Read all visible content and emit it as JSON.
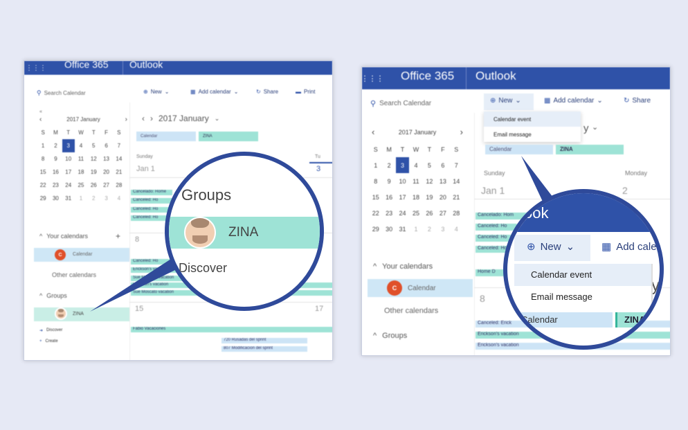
{
  "left_panel": {
    "app_title": "Office 365",
    "app_name": "Outlook",
    "search_placeholder": "Search Calendar",
    "toolbar": {
      "new": "New",
      "add_calendar": "Add calendar",
      "share": "Share",
      "print": "Print"
    },
    "mini_cal": {
      "month_label": "2017 January",
      "weekdays": [
        "S",
        "M",
        "T",
        "W",
        "T",
        "F",
        "S"
      ],
      "weeks": [
        [
          "1",
          "2",
          "3",
          "4",
          "5",
          "6",
          "7"
        ],
        [
          "8",
          "9",
          "10",
          "11",
          "12",
          "13",
          "14"
        ],
        [
          "15",
          "16",
          "17",
          "18",
          "19",
          "20",
          "21"
        ],
        [
          "22",
          "23",
          "24",
          "25",
          "26",
          "27",
          "28"
        ],
        [
          "29",
          "30",
          "31",
          "1",
          "2",
          "3",
          "4"
        ]
      ],
      "today": "3"
    },
    "your_calendars": "Your calendars",
    "calendar_item": "Calendar",
    "avatar_letter": "C",
    "other_calendars": "Other calendars",
    "groups": "Groups",
    "group_item": "ZINA",
    "discover": "Discover",
    "create": "Create",
    "main": {
      "header_title": "2017 January",
      "tag_calendar": "Calendar",
      "tag_zina": "ZINA",
      "day_sunday": "Sunday",
      "day_tue_partial": "Tu",
      "date_jan1": "Jan 1",
      "date_3": "3",
      "date_8": "8",
      "date_15": "15",
      "date_17": "17",
      "events": [
        "Cancelado: Home",
        "Canceled: Ho",
        "Canceled: Ho",
        "Canceled: Ho",
        "Canceled: Ho",
        "Erickson's vacation",
        "Sue Morocco vacation",
        "Fabio Vacaciones",
        "Canceled: Ho",
        "Erickson's vacation",
        "Sue Moscato vacation",
        "Fabio Vacaciones",
        "720 Rusadas del sprint",
        "807 Modificacion del sprint"
      ]
    },
    "magnifier": {
      "groups": "Groups",
      "member": "ZINA",
      "discover": "Discover"
    }
  },
  "right_panel": {
    "app_title": "Office 365",
    "app_name": "Outlook",
    "search_placeholder": "Search Calendar",
    "toolbar": {
      "new": "New",
      "add_calendar": "Add calendar",
      "share": "Share"
    },
    "new_menu": [
      "Calendar event",
      "Email message"
    ],
    "header_partial": "y",
    "mini_cal": {
      "month_label": "2017 January",
      "weekdays": [
        "S",
        "M",
        "T",
        "W",
        "T",
        "F",
        "S"
      ],
      "weeks": [
        [
          "1",
          "2",
          "3",
          "4",
          "5",
          "6",
          "7"
        ],
        [
          "8",
          "9",
          "10",
          "11",
          "12",
          "13",
          "14"
        ],
        [
          "15",
          "16",
          "17",
          "18",
          "19",
          "20",
          "21"
        ],
        [
          "22",
          "23",
          "24",
          "25",
          "26",
          "27",
          "28"
        ],
        [
          "29",
          "30",
          "31",
          "1",
          "2",
          "3",
          "4"
        ]
      ],
      "today": "3"
    },
    "your_calendars": "Your calendars",
    "calendar_item": "Calendar",
    "avatar_letter": "C",
    "other_calendars": "Other calendars",
    "groups": "Groups",
    "main": {
      "tag_calendar": "Calendar",
      "tag_zina": "ZINA",
      "day_sunday": "Sunday",
      "day_monday": "Monday",
      "date_jan1": "Jan 1",
      "date_2": "2",
      "date_8": "8",
      "events": [
        "Cancelado: Hom",
        "Canceled: Ho",
        "Canceled: Ho",
        "Canceled: Ho",
        "Home D",
        "Canceled: Erick",
        "Erickson's vacation",
        "Erickson's vacation"
      ]
    },
    "magnifier": {
      "app_name_partial": "ook",
      "new": "New",
      "add_calendar_partial": "Add cale",
      "menu": [
        "Calendar event",
        "Email message"
      ],
      "tag_calendar": "Calendar",
      "tag_zina": "ZINA",
      "partial_y": "y"
    }
  },
  "colors": {
    "brand": "#2f52a8",
    "today": "#2f52a8",
    "teal": "#9ee3d6",
    "light_blue": "#cde4f6",
    "avatar": "#e0502a",
    "ring": "#2f4a9a",
    "background": "#e6e9f5"
  }
}
